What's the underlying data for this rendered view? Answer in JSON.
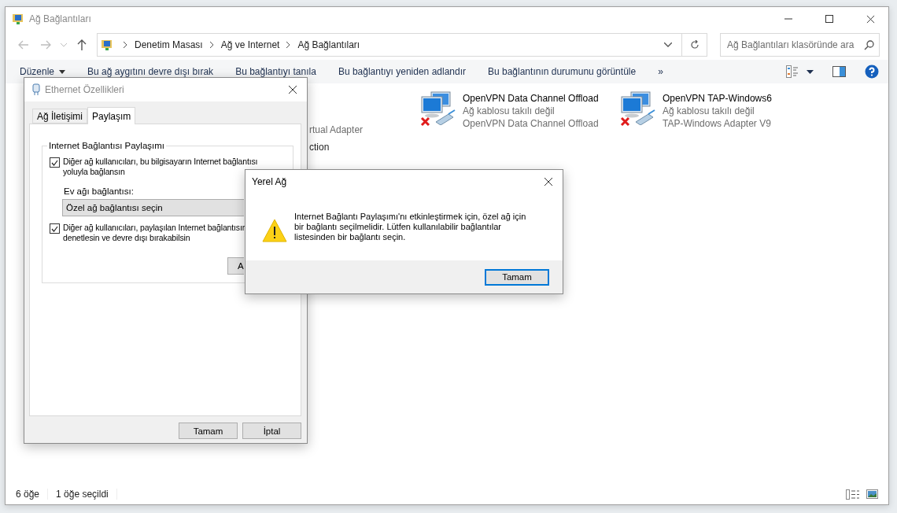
{
  "explorer": {
    "title": "Ağ Bağlantıları",
    "breadcrumb": [
      "Denetim Masası",
      "Ağ ve Internet",
      "Ağ Bağlantıları"
    ],
    "search": {
      "placeholder": "Ağ Bağlantıları klasöründe ara"
    },
    "commands": [
      {
        "label": "Düzenle",
        "kind": "menu"
      },
      {
        "label": "Bu ağ aygıtını devre dışı bırak",
        "kind": "action"
      },
      {
        "label": "Bu bağlantıyı tanıla",
        "kind": "action"
      },
      {
        "label": "Bu bağlantıyı yeniden adlandır",
        "kind": "action"
      },
      {
        "label": "Bu bağlantının durumunu görüntüle",
        "kind": "action"
      },
      {
        "label": "»",
        "kind": "more"
      }
    ],
    "partial_items": [
      {
        "text": "rtual Adapter",
        "kind": "detail"
      },
      {
        "text": "ction",
        "kind": "name"
      }
    ],
    "connections": [
      {
        "name": "OpenVPN Data Channel Offload",
        "status": "Ağ kablosu takılı değil",
        "device": "OpenVPN Data Channel Offload",
        "disconnected": true
      },
      {
        "name": "OpenVPN TAP-Windows6",
        "status": "Ağ kablosu takılı değil",
        "device": "TAP-Windows Adapter V9",
        "disconnected": true
      }
    ],
    "status_bar": [
      "6 öğe",
      "1 öğe seçildi"
    ]
  },
  "properties_dialog": {
    "title": "Ethernet Özellikleri",
    "tabs": [
      {
        "label": "Ağ İletişimi",
        "selected": false
      },
      {
        "label": "Paylaşım",
        "selected": true
      }
    ],
    "group_title": "Internet Bağlantısı Paylaşımı",
    "options": [
      {
        "lines": [
          "Diğer ağ kullanıcıları, bu bilgisayarın Internet bağlantısı",
          "yoluyla bağlansın"
        ],
        "checked": true
      },
      {
        "lines": [
          "Diğer ağ kullanıcıları, paylaşılan Internet bağlantısın",
          "denetlesin ve devre dışı bırakabilsin"
        ],
        "checked": true
      }
    ],
    "home_label": "Ev ağı bağlantısı:",
    "home_value": "Özel ağ bağlantısı seçin",
    "settings_button": "A",
    "buttons": [
      "Tamam",
      "İptal"
    ]
  },
  "message_box": {
    "title": "Yerel Ağ",
    "message": "Internet Bağlantı Paylaşımı'nı etkinleştirmek için, özel ağ için bir bağlantı seçilmelidir. Lütfen kullanılabilir bağlantılar listesinden bir bağlantı seçin.",
    "button": "Tamam"
  }
}
